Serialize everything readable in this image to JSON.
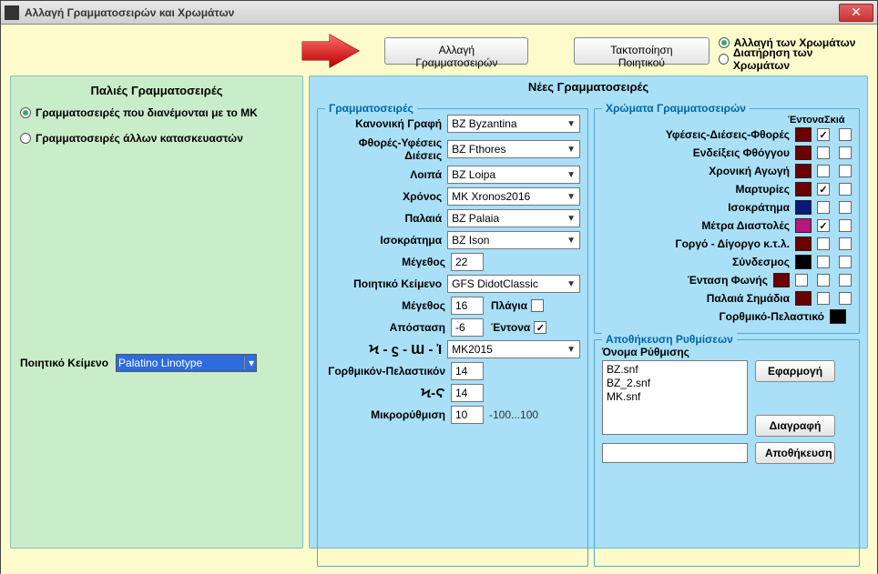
{
  "window": {
    "title": "Αλλαγή Γραμματοσειρών και Χρωμάτων"
  },
  "top": {
    "btn_change_fonts": "Αλλαγή Γραμματοσειρών",
    "btn_arrange_poetic": "Τακτοποίηση Ποιητικού",
    "radio_change_colors": "Αλλαγή των Χρωμάτων",
    "radio_keep_colors": "Διατήρηση των Χρωμάτων",
    "radio_selected": "change"
  },
  "left": {
    "title": "Παλιές Γραμματοσειρές",
    "radio_mk": "Γραμματοσειρές που διανέμονται με το ΜΚ",
    "radio_other": "Γραμματοσειρές άλλων κατασκευαστών",
    "radio_selected": "mk",
    "poetic_label": "Ποιητικό Κείμενο",
    "poetic_value": "Palatino Linotype"
  },
  "right": {
    "title": "Νέες Γραμματοσειρές",
    "fs_fonts": "Γραμματοσειρές",
    "fs_colors": "Χρώματα Γραμματοσειρών",
    "fs_settings": "Αποθήκευση Ρυθμίσεων",
    "settings_name_label": "Όνομα Ρύθμισης",
    "col_entona": "Έντονα",
    "col_skia": "Σκιά",
    "btn_apply": "Εφαρμογή",
    "btn_delete": "Διαγραφή",
    "btn_save": "Αποθήκευση"
  },
  "fonts": {
    "rows": [
      {
        "label": "Κανονική Γραφή",
        "value": "BZ Byzantina",
        "type": "select"
      },
      {
        "label": "Φθορές-Υφέσεις Διέσεις",
        "value": "BZ Fthores",
        "type": "select"
      },
      {
        "label": "Λοιπά",
        "value": "BZ Loipa",
        "type": "select"
      },
      {
        "label": "Χρόνος",
        "value": "MK Xronos2016",
        "type": "select"
      },
      {
        "label": "Παλαιά",
        "value": "BZ Palaia",
        "type": "select"
      },
      {
        "label": "Ισοκράτημα",
        "value": "BZ Ison",
        "type": "select"
      },
      {
        "label": "Μέγεθος",
        "value": "22",
        "type": "num"
      },
      {
        "label": "Ποιητικό Κείμενο",
        "value": "GFS DidotClassic",
        "type": "select"
      }
    ],
    "size2_label": "Μέγεθος",
    "size2_value": "16",
    "italics_label": "Πλάγια",
    "italics_checked": false,
    "spacing_label": "Απόσταση",
    "spacing_value": "-6",
    "bold_label": "Έντονα",
    "bold_checked": true,
    "martyries_label": "Ϟ - ϛ - Ɯ - Ἰ",
    "martyries_value": "MK2015",
    "gorthm_label": "Γορθμικόν-Πελαστικόν",
    "gorthm_value": "14",
    "special_label": "Ϟ-Ϛ",
    "special_value": "14",
    "micro_label": "Μικρορύθμιση",
    "micro_value": "10",
    "micro_hint": "-100...100"
  },
  "colors": {
    "rows": [
      {
        "label": "Υφέσεις-Διέσεις-Φθορές",
        "color": "#6b0000",
        "entona": true,
        "skia": false
      },
      {
        "label": "Ενδείξεις Φθόγγου",
        "color": "#6b0000",
        "entona": false,
        "skia": false
      },
      {
        "label": "Χρονική Αγωγή",
        "color": "#6b0000",
        "entona": false,
        "skia": false
      },
      {
        "label": "Μαρτυρίες",
        "color": "#6b0000",
        "entona": true,
        "skia": false
      },
      {
        "label": "Ισοκράτημα",
        "color": "#0b1a7a",
        "entona": false,
        "skia": false
      },
      {
        "label": "Μέτρα Διαστολές",
        "color": "#b3187c",
        "entona": true,
        "skia": false
      },
      {
        "label": "Γοργό - Δίγοργο κ.τ.λ.",
        "color": "#6b0000",
        "entona": false,
        "skia": false
      },
      {
        "label": "Σύνδεσμος",
        "color": "#000000",
        "entona": false,
        "skia": false
      },
      {
        "label": "Ένταση Φωνής",
        "color": "#6b0000",
        "entona": false,
        "skia": false,
        "extra_skia": true
      },
      {
        "label": "Παλαιά Σημάδια",
        "color": "#6b0000",
        "entona": false,
        "skia": false
      },
      {
        "label": "Γορθμικό-Πελαστικό",
        "color": "#000000",
        "entona": null,
        "skia": null
      }
    ]
  },
  "settings": {
    "items": [
      "BZ.snf",
      "BZ_2.snf",
      "MK.snf"
    ]
  }
}
